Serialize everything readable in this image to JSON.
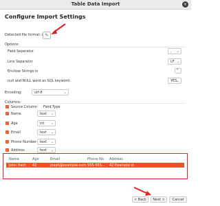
{
  "window": {
    "title": "Table Data Import",
    "close_label": "×"
  },
  "heading": "Configure Import Settings",
  "detected": {
    "label": "Detected file format: csv",
    "edit_icon": "pencil-icon"
  },
  "options": {
    "title": "Options:",
    "field_separator": {
      "label": "Field Separator",
      "value": ","
    },
    "line_separator": {
      "label": "Line Separator",
      "value": "LF"
    },
    "enclose": {
      "label": "Enclose Strings in",
      "value": "\""
    },
    "null_keyword": {
      "label": "null and NULL word as SQL keyword",
      "value": "YES"
    }
  },
  "encoding": {
    "label": "Encoding:",
    "value": "utf-8"
  },
  "columns": {
    "title": "Columns:",
    "header_source": "Source Column",
    "header_type": "Field Type",
    "rows": [
      {
        "name": "Name",
        "type": "text"
      },
      {
        "name": "Age",
        "type": "int"
      },
      {
        "name": "Email",
        "type": "text"
      },
      {
        "name": "Phone Number",
        "type": "text"
      },
      {
        "name": "Address",
        "type": "text"
      }
    ]
  },
  "preview": {
    "headers": [
      "Name",
      "Age",
      "Email",
      "Phone No",
      "Address"
    ],
    "row": [
      "John Hash",
      "42",
      "jnash@example.com",
      "555-555...",
      "42 Example st."
    ]
  },
  "buttons": {
    "back": "< Back",
    "next": "Next >",
    "cancel": "Cancel"
  },
  "colors": {
    "accent": "#e95420",
    "annotation": "#e02020"
  }
}
